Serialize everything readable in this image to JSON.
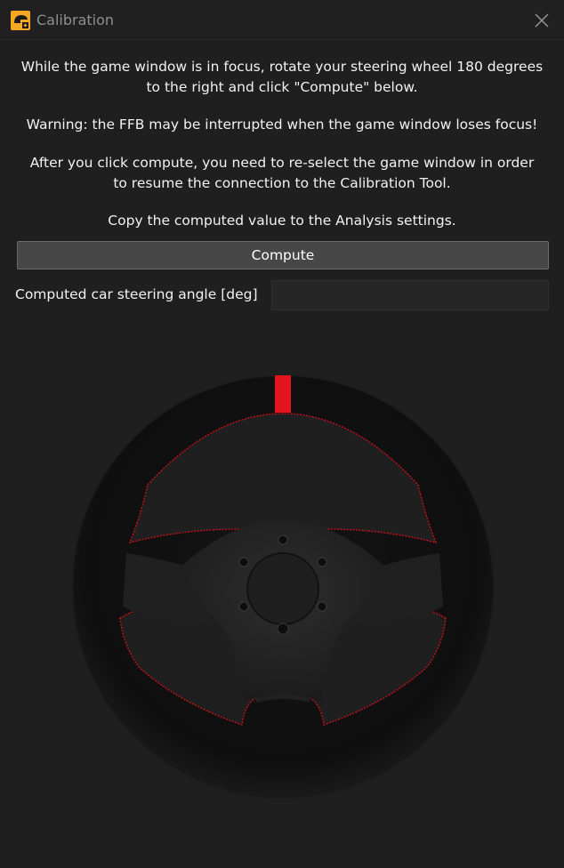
{
  "window": {
    "title": "Calibration",
    "icon": "app-helmet-icon",
    "close_icon": "close-icon"
  },
  "instructions": {
    "line1a": "While the game window is in focus, rotate your steering wheel 180 degrees",
    "line1b": "to the right and click \"Compute\" below.",
    "warning": "Warning: the FFB may be interrupted when the game window loses focus!",
    "line3a": "After you click compute, you need to re-select the game window in order",
    "line3b": "to resume the connection to the Calibration Tool.",
    "line4": "Copy the computed value to the Analysis settings."
  },
  "compute_button": {
    "label": "Compute"
  },
  "steering_angle": {
    "label": "Computed car steering angle [deg]",
    "value": ""
  },
  "colors": {
    "background": "#1f1f1f",
    "accent_red": "#e3141c",
    "button": "#474747",
    "app_icon": "#f5a623"
  }
}
